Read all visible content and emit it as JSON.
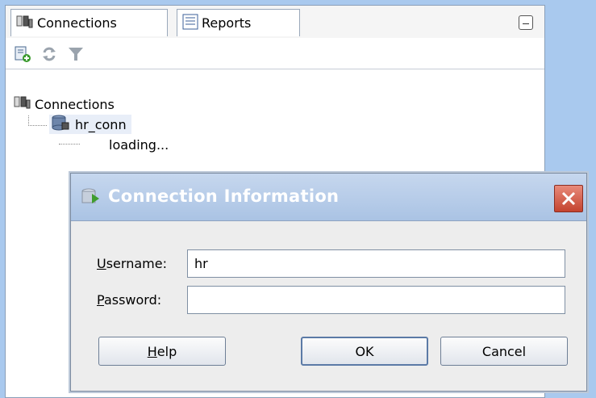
{
  "tabs": [
    {
      "label": "Connections",
      "icon": "connections-icon"
    },
    {
      "label": "Reports",
      "icon": "reports-icon"
    }
  ],
  "toolbar": {
    "icons": [
      "new-connection-icon",
      "refresh-icon",
      "filter-icon"
    ]
  },
  "tree": {
    "root_label": "Connections",
    "connection_label": "hr_conn",
    "loading_label": "loading..."
  },
  "dialog": {
    "title": "Connection Information",
    "username_label_first": "U",
    "username_label_rest": "sername:",
    "username_value": "hr",
    "password_label_first": "P",
    "password_label_rest": "assword:",
    "password_value": "",
    "help_first": "H",
    "help_rest": "elp",
    "ok_label": "OK",
    "cancel_label": "Cancel"
  },
  "colors": {
    "title_bar": "#aac3e4",
    "close_button": "#c4432f",
    "background": "#a9c9ee"
  }
}
